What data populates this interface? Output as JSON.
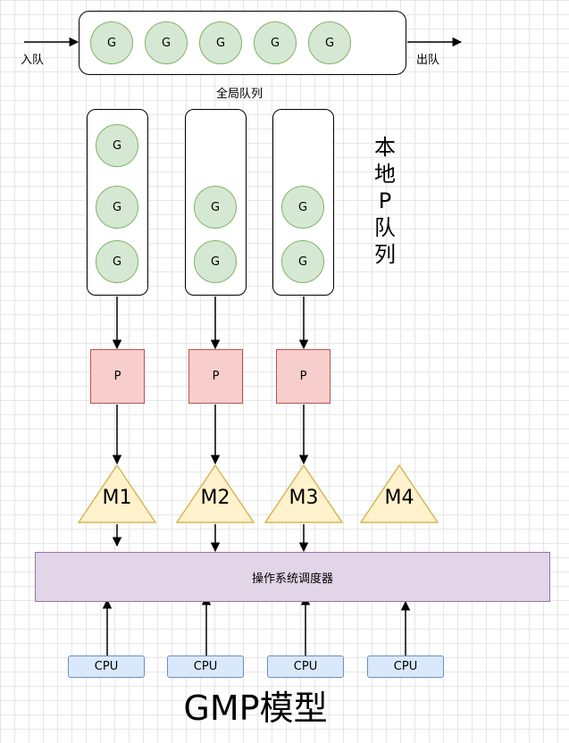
{
  "global_queue": {
    "in_label": "入队",
    "out_label": "出队",
    "caption": "全局队列",
    "goroutines": [
      "G",
      "G",
      "G",
      "G",
      "G"
    ]
  },
  "local_queues": [
    {
      "goroutines": [
        "G",
        "G",
        "G"
      ]
    },
    {
      "goroutines": [
        "G",
        "G"
      ]
    },
    {
      "goroutines": [
        "G",
        "G"
      ]
    }
  ],
  "local_queue_caption": [
    "本",
    "地",
    "P",
    "队",
    "列"
  ],
  "processors": [
    "P",
    "P",
    "P"
  ],
  "machines": [
    "M1",
    "M2",
    "M3",
    "M4"
  ],
  "scheduler_label": "操作系统调度器",
  "cpus": [
    "CPU",
    "CPU",
    "CPU",
    "CPU"
  ],
  "title": "GMP模型",
  "colors": {
    "goroutine_fill": "#d5e8d4",
    "goroutine_stroke": "#82b366",
    "processor_fill": "#f8cecc",
    "processor_stroke": "#b85450",
    "machine_fill": "#fff2cc",
    "machine_stroke": "#d6b656",
    "scheduler_fill": "#e1d5e7",
    "scheduler_stroke": "#9673a6",
    "cpu_fill": "#dae8fc",
    "cpu_stroke": "#6c8ebf"
  }
}
